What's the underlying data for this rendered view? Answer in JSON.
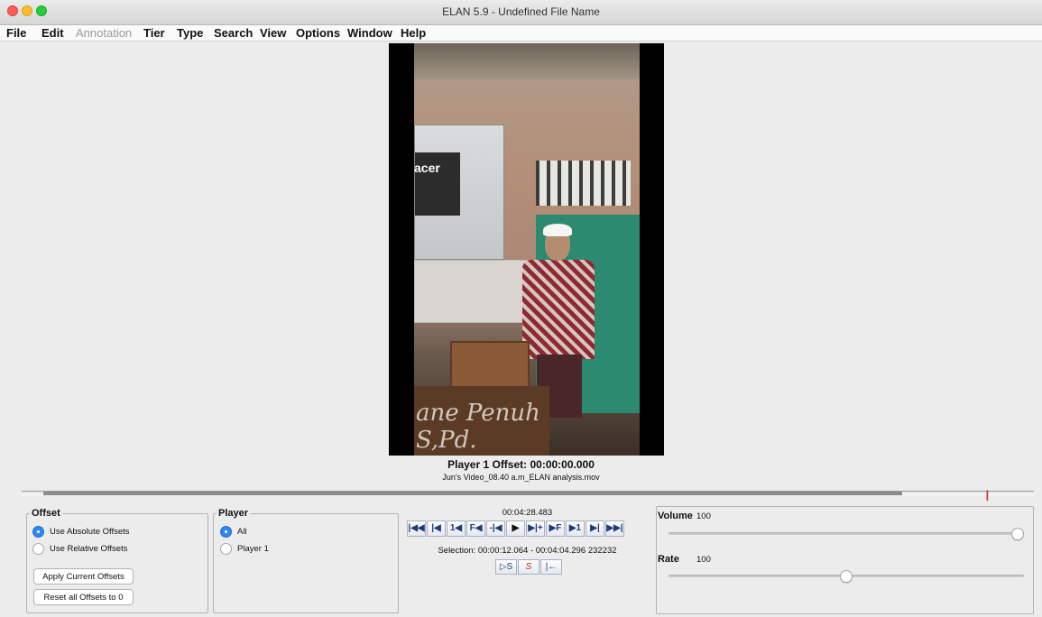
{
  "window": {
    "title": "ELAN 5.9 - Undefined File Name"
  },
  "menu": [
    {
      "label": "File",
      "enabled": true
    },
    {
      "label": "Edit",
      "enabled": true
    },
    {
      "label": "Annotation",
      "enabled": false
    },
    {
      "label": "Tier",
      "enabled": true
    },
    {
      "label": "Type",
      "enabled": true
    },
    {
      "label": "Search",
      "enabled": true
    },
    {
      "label": "View",
      "enabled": true
    },
    {
      "label": "Options",
      "enabled": true
    },
    {
      "label": "Window",
      "enabled": true
    },
    {
      "label": "Help",
      "enabled": true
    }
  ],
  "video": {
    "offset_caption": "Player 1 Offset: 00:00:00.000",
    "file_name": "Jun's Video_08.40 a.m_ELAN analysis.mov"
  },
  "offset_panel": {
    "legend": "Offset",
    "options": [
      {
        "label": "Use Absolute Offsets",
        "checked": true
      },
      {
        "label": "Use Relative Offsets",
        "checked": false
      }
    ],
    "apply_button": "Apply Current Offsets",
    "reset_button": "Reset all Offsets to 0"
  },
  "player_panel": {
    "legend": "Player",
    "options": [
      {
        "label": "All",
        "checked": true
      },
      {
        "label": "Player 1",
        "checked": false
      }
    ]
  },
  "transport": {
    "current_time": "00:04:28.483",
    "buttons": [
      "|◀◀",
      "|◀",
      "1◀",
      "F◀",
      "-|◀",
      "▶",
      "▶|+",
      "▶F",
      "▶1",
      "▶|",
      "▶▶|"
    ],
    "selection": "Selection: 00:00:12.064 - 00:04:04.296  232232",
    "selection_buttons": [
      "▷S",
      "S",
      "|←"
    ]
  },
  "volume": {
    "label": "Volume",
    "value": "100",
    "level": 1.0
  },
  "rate": {
    "label": "Rate",
    "value": "100",
    "level": 0.5
  },
  "colors": {
    "accent": "#2d86f2",
    "background": "#ececec",
    "cursor": "#c62828"
  }
}
